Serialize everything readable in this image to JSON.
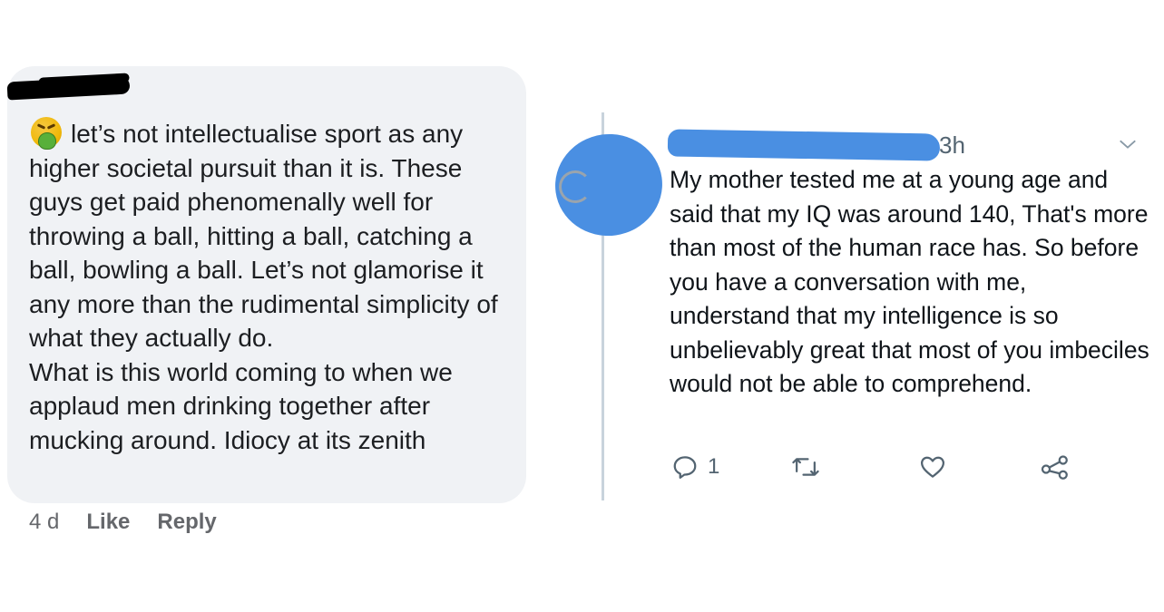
{
  "fb_comment": {
    "text": "let’s not intellectualise sport as any higher societal pursuit than it is. These guys get paid phenomenally well for throwing a ball, hitting a ball, catching a ball, bowling a ball. Let’s not glamorise it any more than the rudimental simplicity of what they actually do.\nWhat is this world coming to when we applaud men drinking together after mucking around. Idiocy at its zenith",
    "emoji_icon": "nauseated-face-icon",
    "timestamp": "4 d",
    "like_label": "Like",
    "reply_label": "Reply"
  },
  "tweet": {
    "time": "3h",
    "text": "My mother tested me at a young age and said that my IQ was around 140, That's more than most of the human race has. So before you have a conversation with me, understand that my intelligence is so unbelievably great that most of you imbeciles would not be able to comprehend.",
    "reply_count": "1",
    "icons": [
      "reply-icon",
      "retweet-icon",
      "like-heart-icon",
      "share-icon",
      "chevron-down-icon"
    ]
  },
  "colors": {
    "bubble_bg": "#f0f2f5",
    "redaction_blue": "#4a8fe2",
    "muted_text": "#65676b",
    "tweet_icon": "#536471"
  }
}
